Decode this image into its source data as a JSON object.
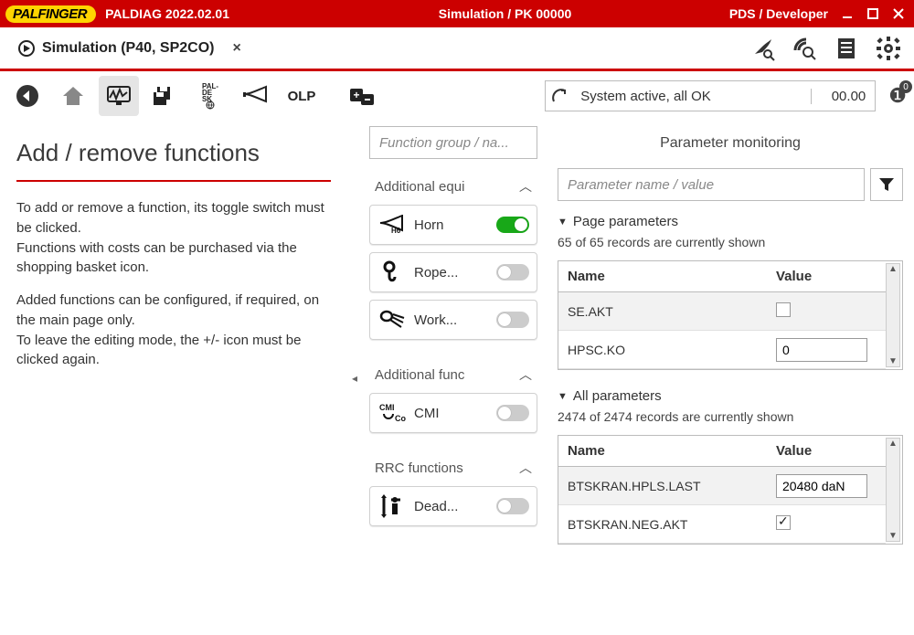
{
  "titlebar": {
    "brand": "PALFINGER",
    "app": "PALDIAG 2022.02.01",
    "center": "Simulation / PK 00000",
    "right": "PDS / Developer"
  },
  "tab": {
    "label": "Simulation (P40, SP2CO)"
  },
  "status": {
    "text": "System active, all OK",
    "value": "00.00",
    "info_count": "0"
  },
  "toolbar": {
    "olp": "OLP"
  },
  "left": {
    "heading": "Add / remove functions",
    "p1": "To add or remove a function, its toggle switch must be clicked.",
    "p2": "Functions with costs can be purchased via the shopping basket icon.",
    "p3": "Added functions can be configured, if required, on the main page only.",
    "p4": "To leave the editing mode, the +/- icon must be clicked again."
  },
  "mid": {
    "search_placeholder": "Function group / na...",
    "groups": [
      {
        "title": "Additional equi",
        "items": [
          {
            "icon": "horn-h6-icon",
            "label": "Horn",
            "on": true
          },
          {
            "icon": "rope-winch-icon",
            "label": "Rope...",
            "on": false
          },
          {
            "icon": "worklight-icon",
            "label": "Work...",
            "on": false
          }
        ]
      },
      {
        "title": "Additional func",
        "items": [
          {
            "icon": "cmi-icon",
            "label": "CMI",
            "on": false
          }
        ]
      },
      {
        "title": "RRC functions",
        "items": [
          {
            "icon": "deadman-icon",
            "label": "Dead...",
            "on": false
          }
        ]
      }
    ]
  },
  "right": {
    "title": "Parameter monitoring",
    "filter_placeholder": "Parameter name / value",
    "page_section": {
      "title": "Page parameters",
      "sub": "65 of 65 records are currently shown",
      "col_name": "Name",
      "col_value": "Value",
      "rows": [
        {
          "name": "SE.AKT",
          "kind": "checkbox",
          "checked": false
        },
        {
          "name": "HPSC.KO",
          "kind": "input",
          "value": "0"
        }
      ]
    },
    "all_section": {
      "title": "All parameters",
      "sub": "2474 of 2474 records are currently shown",
      "col_name": "Name",
      "col_value": "Value",
      "rows": [
        {
          "name": "BTSKRAN.HPLS.LAST",
          "kind": "input",
          "value": "20480 daN"
        },
        {
          "name": "BTSKRAN.NEG.AKT",
          "kind": "checkbox",
          "checked": true
        }
      ]
    }
  }
}
